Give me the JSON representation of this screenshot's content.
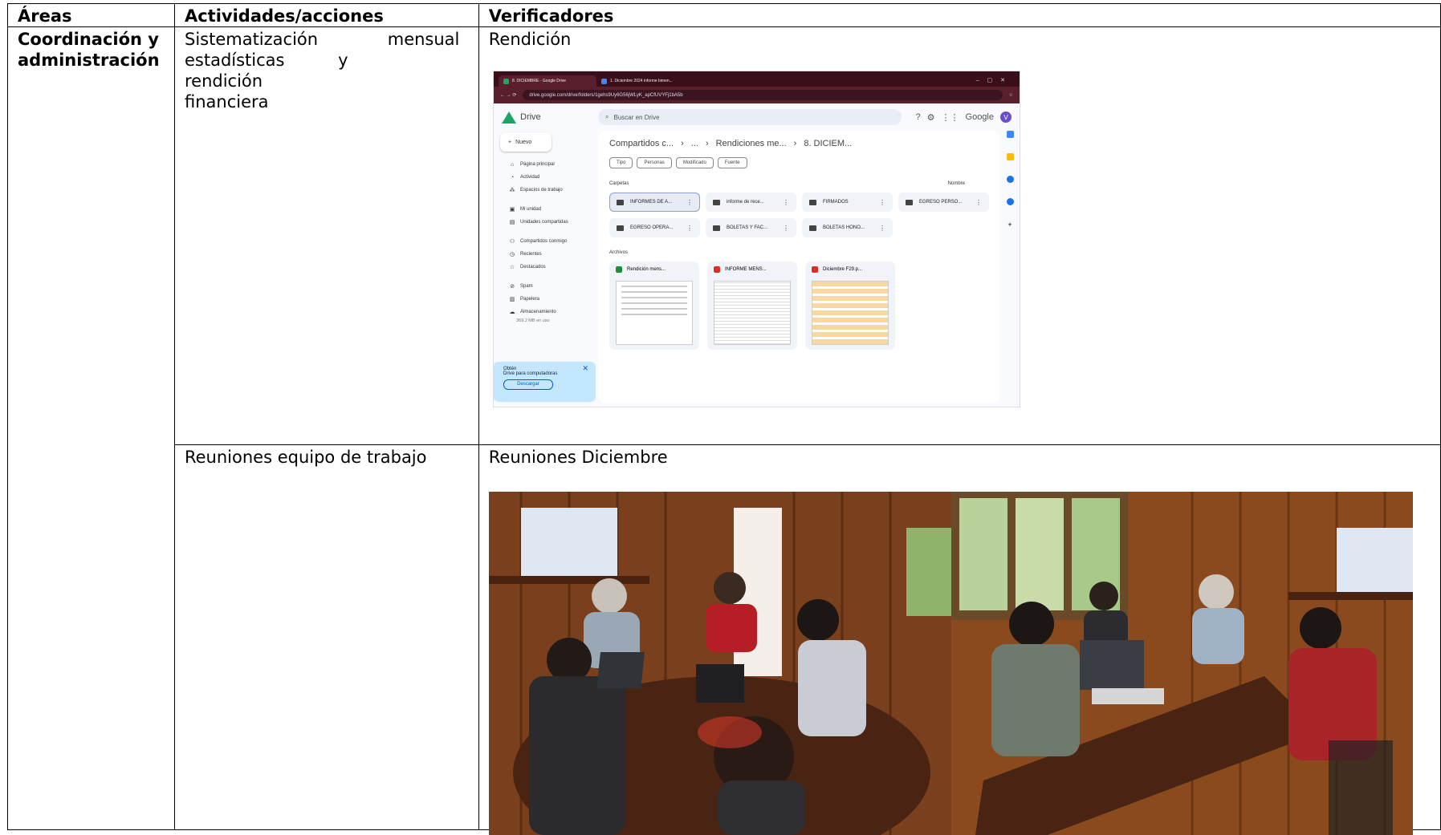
{
  "table": {
    "headers": [
      "Áreas",
      "Actividades/acciones",
      "Verificadores"
    ],
    "area": "Coordinación y administración",
    "rows": [
      {
        "activity_lines": [
          "Sistematización mensual",
          "estadísticas y rendición",
          "financiera"
        ],
        "verifier": "Rendición"
      },
      {
        "activity": "Reuniones equipo de trabajo",
        "verifier": "Reuniones Diciembre"
      }
    ]
  },
  "drive_screenshot": {
    "tabs": [
      "8. DICIEMBRE - Google Drive",
      "1. Diciembre 2024 informe bimen..."
    ],
    "url": "drive.google.com/drive/folders/1gehs9Uy6G56jWLyK_apCfUVYFj1bA5b",
    "app_name": "Drive",
    "search_placeholder": "Buscar en Drive",
    "brand": "Google",
    "avatar_letter": "V",
    "new_button": "Nuevo",
    "sidebar": [
      "Página principal",
      "Actividad",
      "Espacios de trabajo",
      "Mi unidad",
      "Unidades compartidas",
      "Compartidos conmigo",
      "Recientes",
      "Destacados",
      "Spam",
      "Papelera",
      "Almacenamiento"
    ],
    "storage_used": "369.2 MB en uso",
    "promo_title": "Obtén",
    "promo_text": "Drive para computadoras",
    "promo_button": "Descargar",
    "breadcrumb": [
      "Compartidos c...",
      "...",
      "Rendiciones me...",
      "8. DICIEM..."
    ],
    "filters": [
      "Tipo",
      "Personas",
      "Modificado",
      "Fuente"
    ],
    "folders_label": "Carpetas",
    "sort_label": "Nombre",
    "folders": [
      "INFORMES DE A...",
      "informe de rece...",
      "FIRMADOS",
      "EGRESO PERSO...",
      "EGRESO OPERA...",
      "BOLETAS Y FAC...",
      "BOLETAS HONO..."
    ],
    "files_label": "Archivos",
    "files": [
      {
        "name": "Rendición mens...",
        "color": "#1e8e3e"
      },
      {
        "name": "INFORME MENS...",
        "color": "#d93025"
      },
      {
        "name": "Diciembre F29.p...",
        "color": "#d93025"
      }
    ]
  },
  "photos": [
    "team-meeting-photo-1",
    "team-meeting-photo-2"
  ]
}
